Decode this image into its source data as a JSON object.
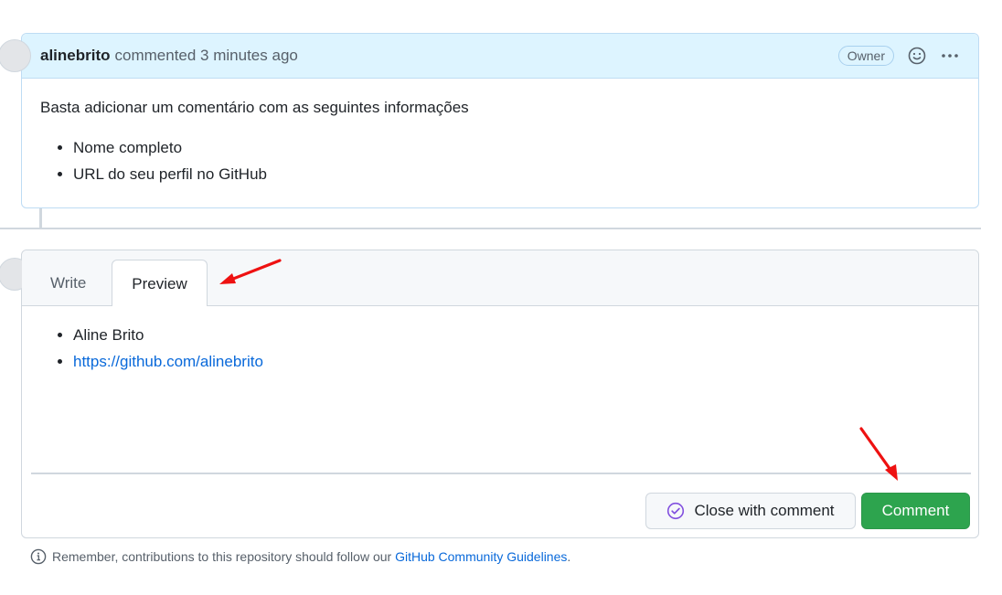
{
  "existing_comment": {
    "author": "alinebrito",
    "action_text": "commented 3 minutes ago",
    "badge": "Owner",
    "reaction_icon": "smiley-icon",
    "more_icon": "kebab-horizontal-icon",
    "body_text": "Basta adicionar um comentário com as seguintes informações",
    "list_items": [
      "Nome completo",
      "URL do seu perfil no GitHub"
    ]
  },
  "editor": {
    "tabs": {
      "write": "Write",
      "preview": "Preview"
    },
    "active_tab": "Preview",
    "preview_items": [
      "Aline Brito"
    ],
    "preview_link": "https://github.com/alinebrito",
    "close_button": "Close with comment",
    "close_icon": "issue-closed-icon",
    "comment_button": "Comment"
  },
  "footer": {
    "icon": "info-icon",
    "text": "Remember, contributions to this repository should follow our",
    "link_text": "GitHub Community Guidelines",
    "suffix": "."
  },
  "colors": {
    "header_bg": "#ddf4ff",
    "accent_blue": "#0969da",
    "primary_green": "#2da44e",
    "annotation_arrow": "#ee1111",
    "close_icon_purple": "#8250df"
  }
}
